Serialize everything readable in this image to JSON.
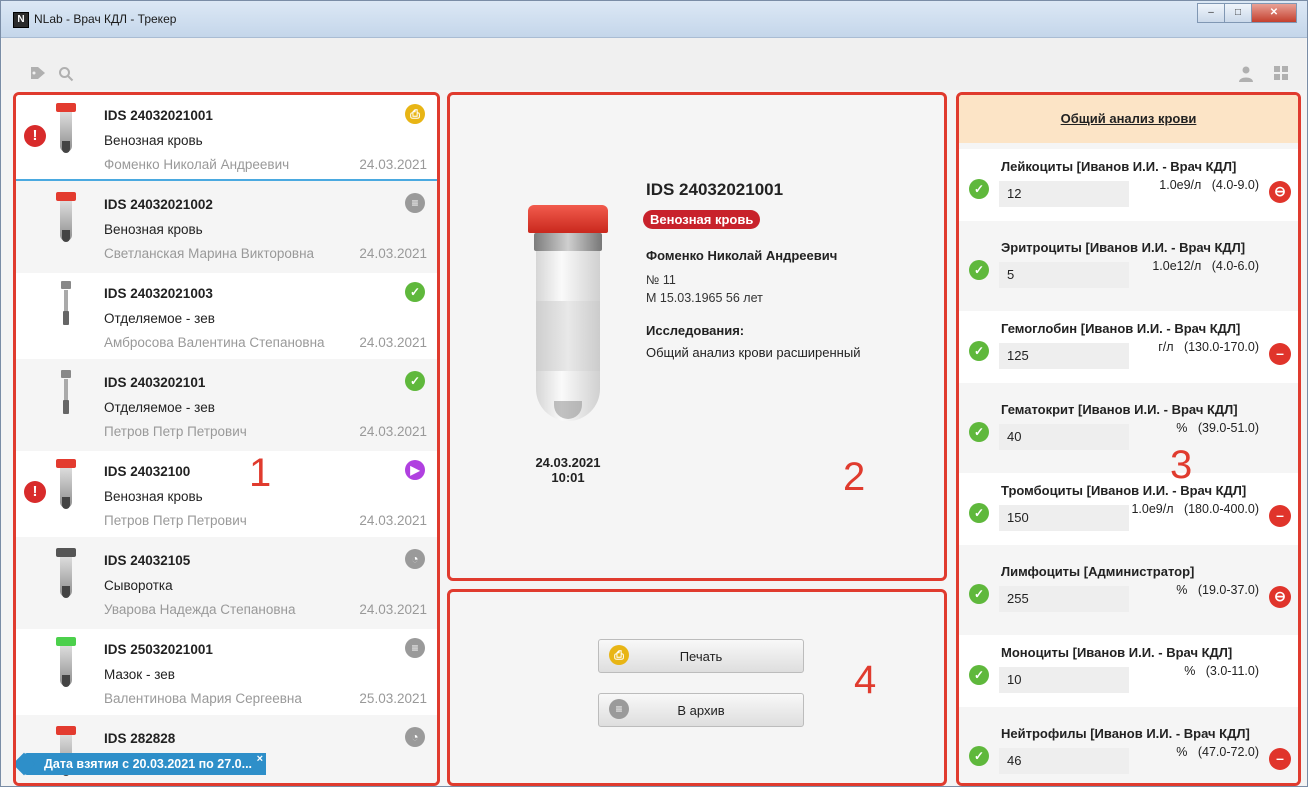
{
  "window": {
    "app_icon": "N",
    "title": "NLab - Врач КДЛ - Трекер",
    "minimize": "–",
    "maximize": "□",
    "close": "✕"
  },
  "toolbar": {
    "tag_icon": "tag-icon",
    "search_icon": "search-icon",
    "user_icon": "user-icon",
    "grid_icon": "grid-icon"
  },
  "annotations": {
    "n1": "1",
    "n2": "2",
    "n3": "3",
    "n4": "4"
  },
  "samples": [
    {
      "id": "IDS 24032021001",
      "material": "Венозная кровь",
      "patient": "Фоменко Николай Андреевич",
      "date": "24.03.2021",
      "status": "print",
      "status_glyph": "⎙",
      "warn": "!",
      "cap": "#e33b2f"
    },
    {
      "id": "IDS 24032021002",
      "material": "Венозная кровь",
      "patient": "Светланская Марина Викторовна",
      "date": "24.03.2021",
      "status": "archive",
      "status_glyph": "≡",
      "warn": "",
      "cap": "#e33b2f"
    },
    {
      "id": "IDS 24032021003",
      "material": "Отделяемое - зев",
      "patient": "Амбросова Валентина Степановна",
      "date": "24.03.2021",
      "status": "done",
      "status_glyph": "✓",
      "warn": "",
      "cap": "#888888"
    },
    {
      "id": "IDS 2403202101",
      "material": "Отделяемое - зев",
      "patient": "Петров Петр Петрович",
      "date": "24.03.2021",
      "status": "done",
      "status_glyph": "✓",
      "warn": "",
      "cap": "#888888"
    },
    {
      "id": "IDS 24032100",
      "material": "Венозная кровь",
      "patient": "Петров Петр Петрович",
      "date": "24.03.2021",
      "status": "play",
      "status_glyph": "▶",
      "warn": "!",
      "cap": "#e33b2f"
    },
    {
      "id": "IDS 24032105",
      "material": "Сыворотка",
      "patient": "Уварова Надежда Степановна",
      "date": "24.03.2021",
      "status": "pending",
      "status_glyph": "◔",
      "warn": "",
      "cap": "#555555"
    },
    {
      "id": "IDS 25032021001",
      "material": "Мазок - зев",
      "patient": "Валентинова Мария Сергеевна",
      "date": "25.03.2021",
      "status": "archive",
      "status_glyph": "≡",
      "warn": "",
      "cap": "#4cd04c"
    },
    {
      "id": "IDS 282828",
      "material": "",
      "patient": "",
      "date": "",
      "status": "pending",
      "status_glyph": "◔",
      "warn": "",
      "cap": "#e33b2f"
    }
  ],
  "filter": {
    "label": "Дата взятия с 20.03.2021 по 27.0...",
    "close": "×"
  },
  "detail": {
    "id": "IDS 24032021001",
    "material": "Венозная кровь",
    "patient": "Фоменко Николай Андреевич",
    "number": "№ 11",
    "sex_age": "М 15.03.1965 56 лет",
    "research_heading": "Исследования:",
    "research": "Общий анализ крови расширенный",
    "date": "24.03.2021",
    "time": "10:01"
  },
  "actions": {
    "print_label": "Печать",
    "print_glyph": "⎙",
    "archive_label": "В архив",
    "archive_glyph": "≡"
  },
  "results": {
    "title": "Общий анализ крови",
    "items": [
      {
        "name": "Лейкоциты [Иванов И.И. - Врач КДЛ]",
        "value": "12",
        "unit": "1.0e9/л",
        "range": "(4.0-9.0)",
        "flag": "⊖"
      },
      {
        "name": "Эритроциты  [Иванов И.И. - Врач КДЛ]",
        "value": "5",
        "unit": "1.0e12/л",
        "range": "(4.0-6.0)",
        "flag": ""
      },
      {
        "name": "Гемоглобин [Иванов И.И. - Врач КДЛ]",
        "value": "125",
        "unit": "г/л",
        "range": "(130.0-170.0)",
        "flag": "–"
      },
      {
        "name": "Гематокрит [Иванов И.И. - Врач КДЛ]",
        "value": "40",
        "unit": "%",
        "range": "(39.0-51.0)",
        "flag": ""
      },
      {
        "name": "Тромбоциты [Иванов И.И. - Врач КДЛ]",
        "value": "150",
        "unit": "1.0e9/л",
        "range": "(180.0-400.0)",
        "flag": "–"
      },
      {
        "name": "Лимфоциты  [Администратор]",
        "value": "255",
        "unit": "%",
        "range": "(19.0-37.0)",
        "flag": "⊖"
      },
      {
        "name": "Моноциты  [Иванов И.И. - Врач КДЛ]",
        "value": "10",
        "unit": "%",
        "range": "(3.0-11.0)",
        "flag": ""
      },
      {
        "name": "Нейтрофилы [Иванов И.И. - Врач КДЛ]",
        "value": "46",
        "unit": "%",
        "range": "(47.0-72.0)",
        "flag": "–"
      }
    ]
  },
  "colors": {
    "annotation": "#e03b2e",
    "print": "#e8b515",
    "archive": "#9a9a9a",
    "done": "#5fb83c",
    "play": "#b040e0",
    "pending": "#9a9a9a",
    "warn": "#d82b2b",
    "filter": "#2e8fc9"
  }
}
